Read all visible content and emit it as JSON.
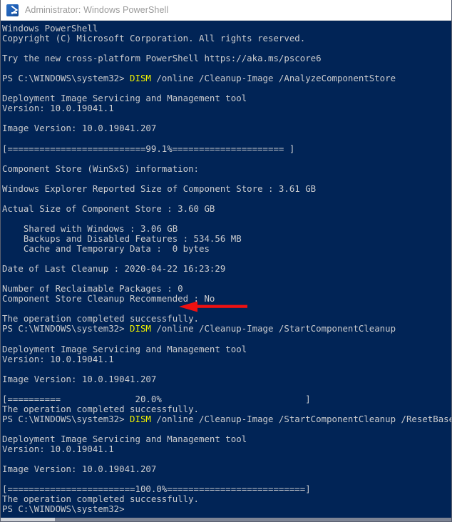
{
  "window": {
    "title": "Administrator: Windows PowerShell",
    "icon": "powershell-icon",
    "background_color": "#012456",
    "text_color": "#ccccce",
    "command_color": "#f2f200",
    "titlebar_background": "#ffffff",
    "titlebar_text_color": "#9a9a9a"
  },
  "annotation": {
    "type": "arrow",
    "color": "#ee1111",
    "direction": "left",
    "points_at": "Number of Reclaimable Packages : 0"
  },
  "scrollbar": {
    "orientation": "horizontal",
    "thumb_color": "#cfd2d8",
    "track_color": "#7d8494"
  },
  "console": {
    "prompt": "PS C:\\WINDOWS\\system32>",
    "commands": [
      "DISM /online /Cleanup-Image /AnalyzeComponentStore",
      "DISM /online /Cleanup-Image /StartComponentCleanup",
      "DISM /online /Cleanup-Image /StartComponentCleanup /ResetBase"
    ],
    "progress_bars": [
      {
        "percent": "99.1%",
        "bar": "[==========================99.1%===================== ]"
      },
      {
        "percent": "20.0%",
        "bar": "[==========              20.0%                           ]"
      },
      {
        "percent": "100.0%",
        "bar": "[========================100.0%==========================]"
      }
    ],
    "component_store": {
      "heading": "Component Store (WinSxS) information:",
      "explorer_reported_size": "3.61 GB",
      "actual_size": "3.60 GB",
      "shared_with_windows": "3.06 GB",
      "backups_and_disabled_features": "534.56 MB",
      "cache_and_temporary_data": "0 bytes",
      "date_of_last_cleanup": "2020-04-22 16:23:29",
      "number_of_reclaimable_packages": "0",
      "cleanup_recommended": "No"
    },
    "dism_tool": {
      "name": "Deployment Image Servicing and Management tool",
      "version": "10.0.19041.1",
      "image_version": "10.0.19041.207"
    },
    "lines": [
      {
        "text": "Windows PowerShell"
      },
      {
        "text": "Copyright (C) Microsoft Corporation. All rights reserved."
      },
      {
        "text": ""
      },
      {
        "text": "Try the new cross-platform PowerShell https://aka.ms/pscore6"
      },
      {
        "text": ""
      },
      {
        "prompt": "PS C:\\WINDOWS\\system32> ",
        "cmd": "DISM",
        "rest": " /online /Cleanup-Image /AnalyzeComponentStore"
      },
      {
        "text": ""
      },
      {
        "text": "Deployment Image Servicing and Management tool"
      },
      {
        "text": "Version: 10.0.19041.1"
      },
      {
        "text": ""
      },
      {
        "text": "Image Version: 10.0.19041.207"
      },
      {
        "text": ""
      },
      {
        "text": "[==========================99.1%===================== ]"
      },
      {
        "text": ""
      },
      {
        "text": "Component Store (WinSxS) information:"
      },
      {
        "text": ""
      },
      {
        "text": "Windows Explorer Reported Size of Component Store : 3.61 GB"
      },
      {
        "text": ""
      },
      {
        "text": "Actual Size of Component Store : 3.60 GB"
      },
      {
        "text": ""
      },
      {
        "text": "    Shared with Windows : 3.06 GB"
      },
      {
        "text": "    Backups and Disabled Features : 534.56 MB"
      },
      {
        "text": "    Cache and Temporary Data :  0 bytes"
      },
      {
        "text": ""
      },
      {
        "text": "Date of Last Cleanup : 2020-04-22 16:23:29"
      },
      {
        "text": ""
      },
      {
        "text": "Number of Reclaimable Packages : 0"
      },
      {
        "text": "Component Store Cleanup Recommended : No"
      },
      {
        "text": ""
      },
      {
        "text": "The operation completed successfully."
      },
      {
        "prompt": "PS C:\\WINDOWS\\system32> ",
        "cmd": "DISM",
        "rest": " /online /Cleanup-Image /StartComponentCleanup"
      },
      {
        "text": ""
      },
      {
        "text": "Deployment Image Servicing and Management tool"
      },
      {
        "text": "Version: 10.0.19041.1"
      },
      {
        "text": ""
      },
      {
        "text": "Image Version: 10.0.19041.207"
      },
      {
        "text": ""
      },
      {
        "text": "[==========              20.0%                           ]"
      },
      {
        "text": "The operation completed successfully."
      },
      {
        "prompt": "PS C:\\WINDOWS\\system32> ",
        "cmd": "DISM",
        "rest": " /online /Cleanup-Image /StartComponentCleanup /ResetBase"
      },
      {
        "text": ""
      },
      {
        "text": "Deployment Image Servicing and Management tool"
      },
      {
        "text": "Version: 10.0.19041.1"
      },
      {
        "text": ""
      },
      {
        "text": "Image Version: 10.0.19041.207"
      },
      {
        "text": ""
      },
      {
        "text": "[========================100.0%==========================]"
      },
      {
        "text": "The operation completed successfully."
      },
      {
        "prompt": "PS C:\\WINDOWS\\system32>",
        "cmd": "",
        "rest": ""
      }
    ]
  }
}
